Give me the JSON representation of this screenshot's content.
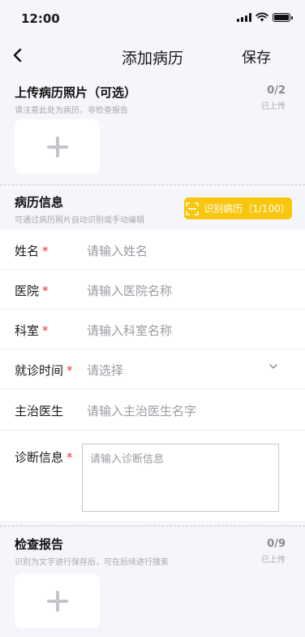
{
  "status": {
    "time": "12:00"
  },
  "nav": {
    "title": "添加病历",
    "save_label": "保存"
  },
  "photos": {
    "title": "上传病历照片（可选）",
    "subtitle": "请注意此处为病历，非检查报告",
    "count": "0/2",
    "count_label": "已上传"
  },
  "info": {
    "title": "病历信息",
    "subtitle": "可通过病历照片自动识别或手动编辑",
    "ocr_label": "识别病历（1/100）"
  },
  "form": {
    "name": {
      "label": "姓名",
      "placeholder": "请输入姓名",
      "required": "*"
    },
    "hospital": {
      "label": "医院",
      "placeholder": "请输入医院名称",
      "required": "*"
    },
    "department": {
      "label": "科室",
      "placeholder": "请输入科室名称",
      "required": "*"
    },
    "visit_time": {
      "label": "就诊时间",
      "placeholder": "请选择",
      "required": "*"
    },
    "doctor": {
      "label": "主治医生",
      "placeholder": "请输入主治医生名字"
    },
    "diagnosis": {
      "label": "诊断信息",
      "placeholder": "请输入诊断信息",
      "required": "*"
    }
  },
  "reports": {
    "title": "检查报告",
    "subtitle": "识别为文字进行保存后，可在后续进行搜索",
    "count": "0/9",
    "count_label": "已上传"
  },
  "colors": {
    "accent": "#f8c60d",
    "required": "#ee3333",
    "background": "#f5f6fb"
  }
}
